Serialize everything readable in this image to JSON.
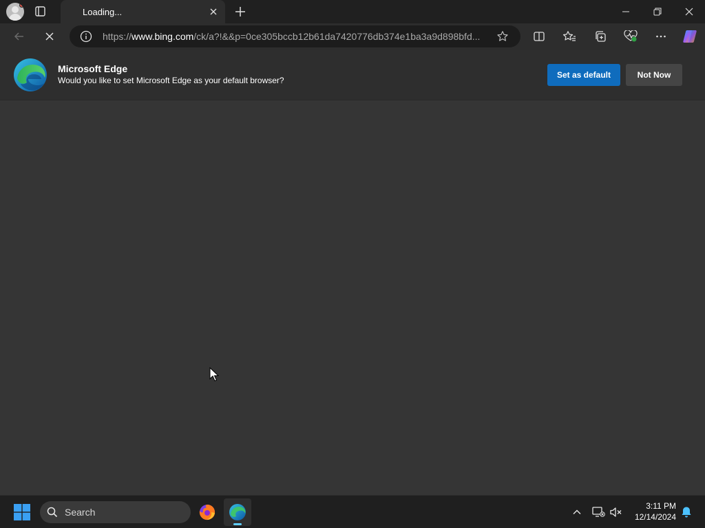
{
  "window": {
    "tab_title": "Loading...",
    "colors": {
      "frame": "#202020",
      "toolbar": "#2d2d2d",
      "content": "#353535",
      "accent": "#0f6cbd"
    }
  },
  "toolbar": {
    "url_prefix": "https://",
    "url_domain": "www.bing.com",
    "url_path": "/ck/a?!&&p=0ce305bccb12b61da7420776db374e1ba3a9d898bfd...",
    "icons": [
      "back-icon",
      "stop-loading-icon",
      "site-info-icon",
      "favorite-star-icon",
      "split-screen-icon",
      "favorites-icon",
      "collections-icon",
      "browser-essentials-icon",
      "more-icon",
      "copilot-icon"
    ]
  },
  "infobar": {
    "title": "Microsoft Edge",
    "message": "Would you like to set Microsoft Edge as your default browser?",
    "primary_button": "Set as default",
    "secondary_button": "Not Now"
  },
  "taskbar": {
    "search_placeholder": "Search",
    "apps": [
      "firefox-icon",
      "edge-icon"
    ],
    "time": "3:11 PM",
    "date": "12/14/2024"
  }
}
